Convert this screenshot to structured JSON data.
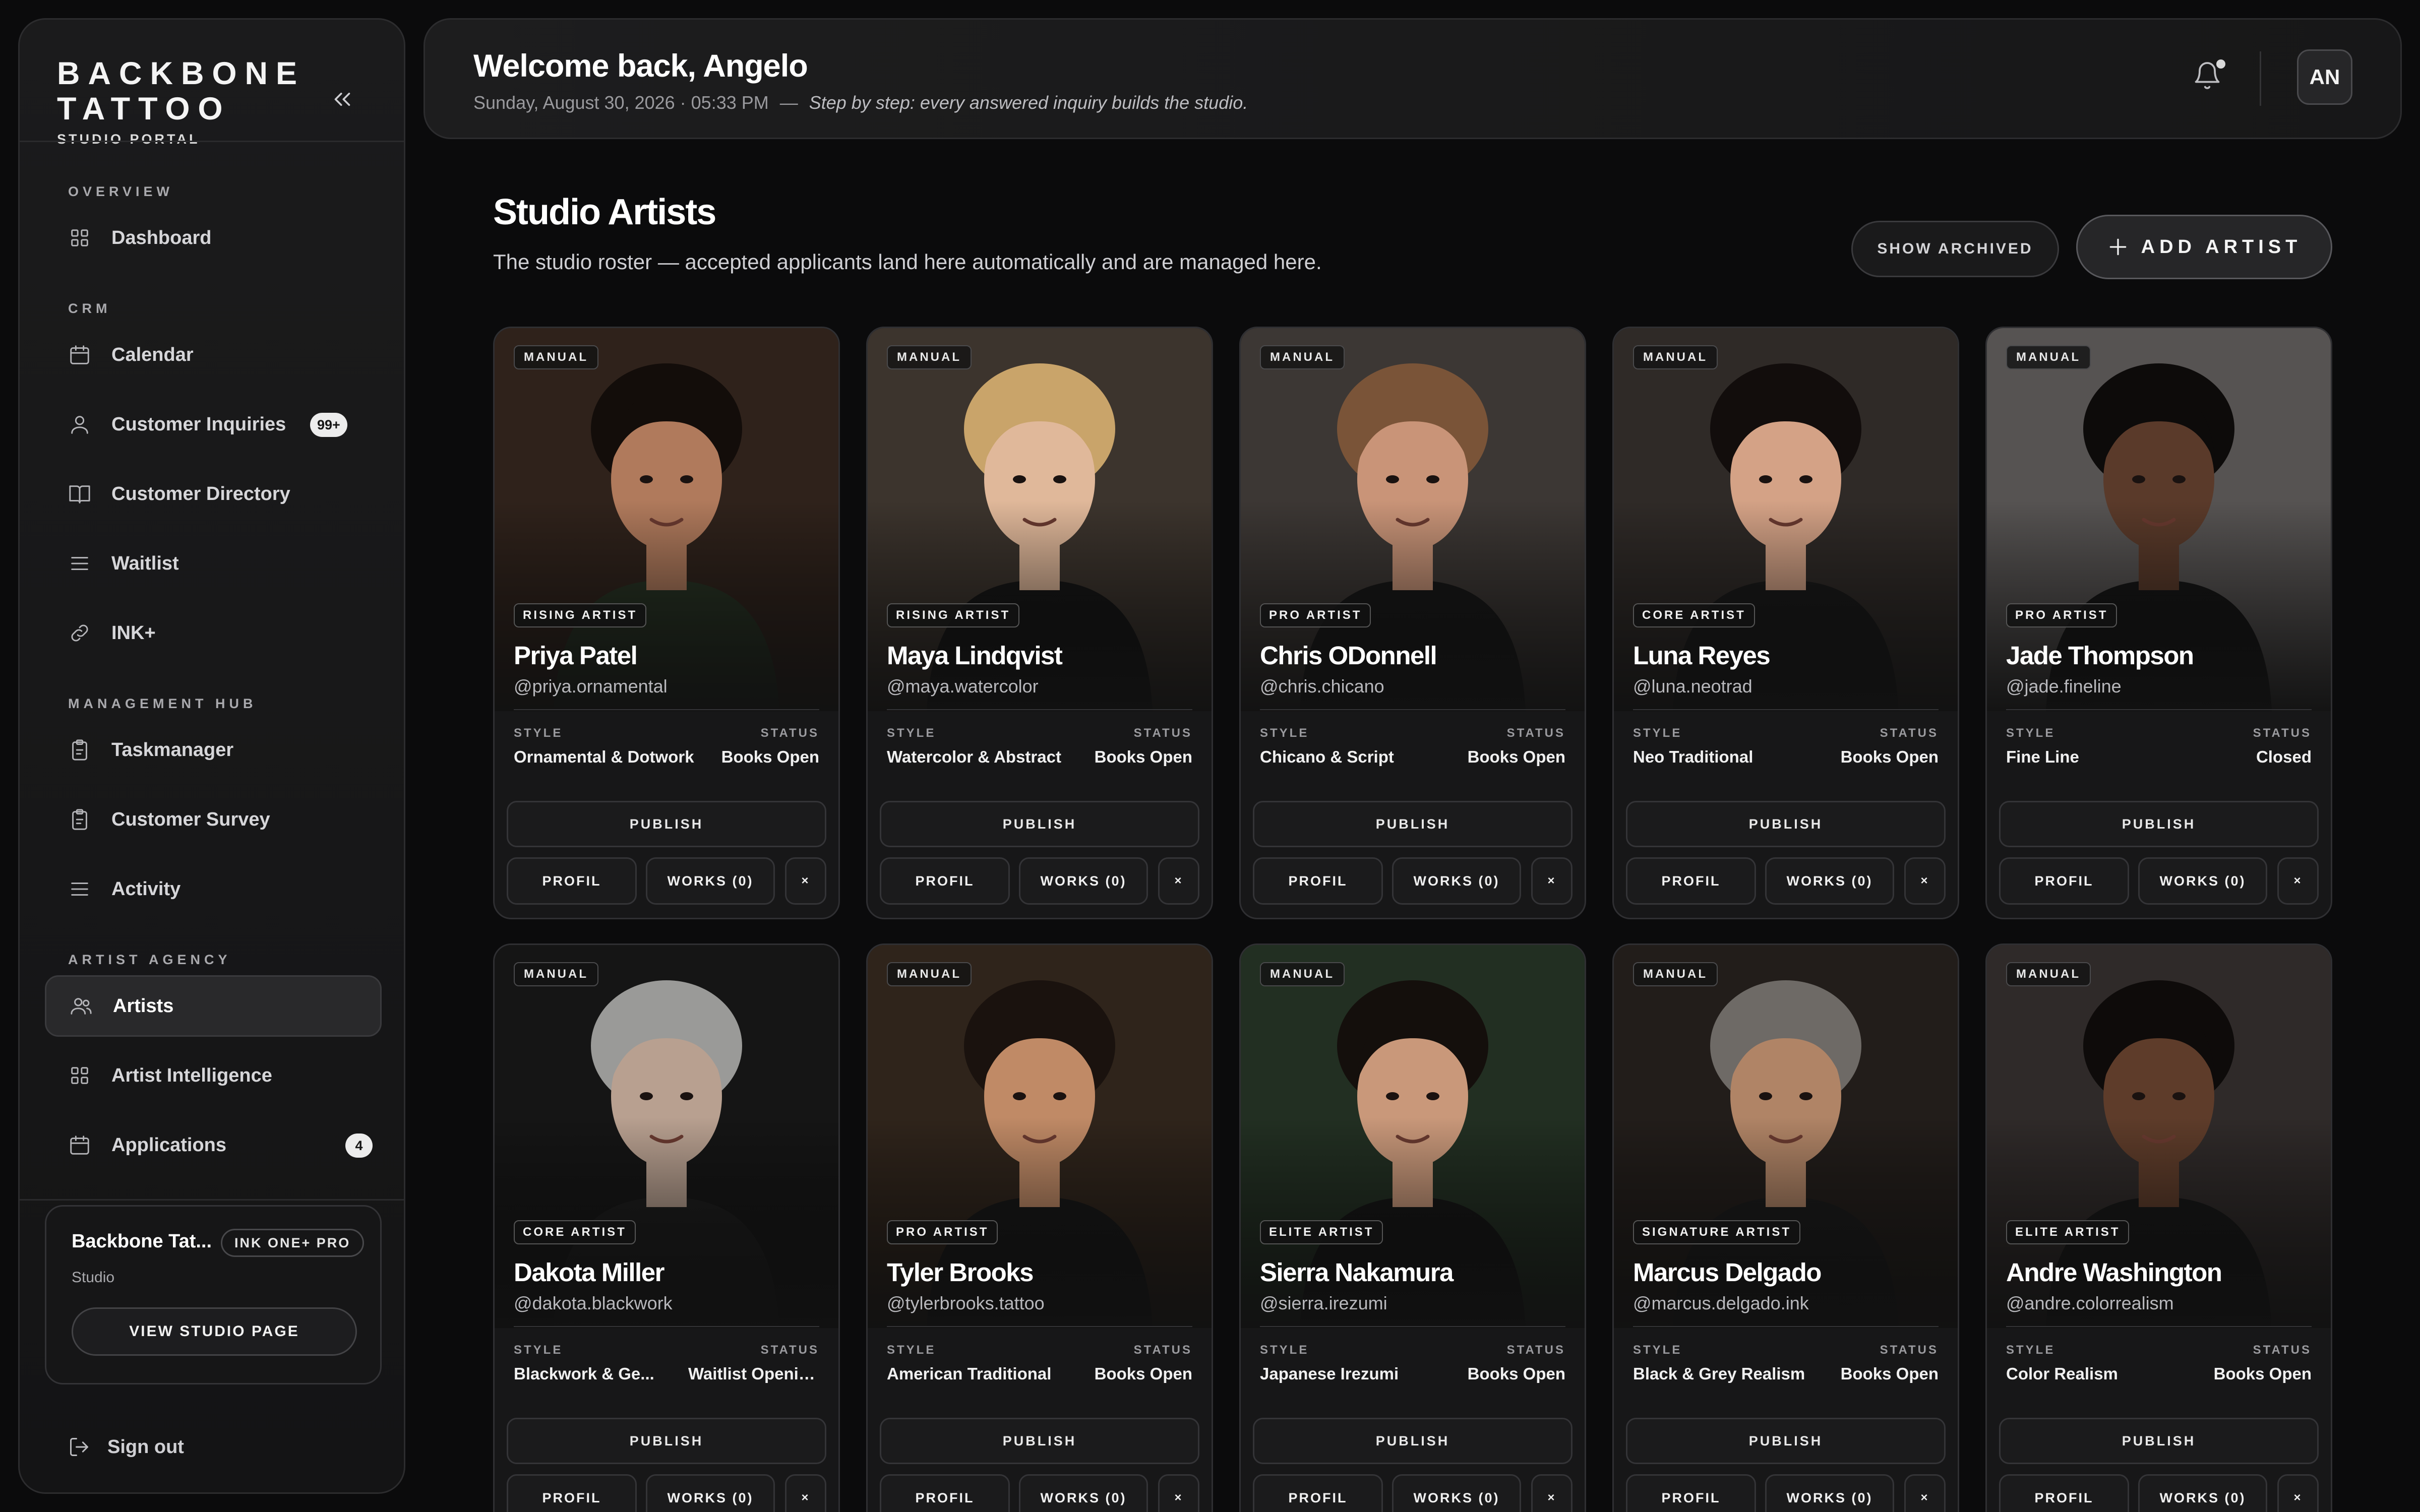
{
  "sidebar": {
    "brand_name": "BACKBONE TATTOO",
    "brand_sub": "STUDIO PORTAL",
    "sections": [
      {
        "title": "OVERVIEW",
        "items": [
          {
            "label": "Dashboard",
            "icon": "grid-icon"
          }
        ]
      },
      {
        "title": "CRM",
        "items": [
          {
            "label": "Calendar",
            "icon": "calendar-icon"
          },
          {
            "label": "Customer Inquiries",
            "icon": "user-icon",
            "badge": "99+"
          },
          {
            "label": "Customer Directory",
            "icon": "book-icon"
          },
          {
            "label": "Waitlist",
            "icon": "list-icon"
          },
          {
            "label": "INK+",
            "icon": "link-icon"
          }
        ]
      },
      {
        "title": "MANAGEMENT HUB",
        "items": [
          {
            "label": "Taskmanager",
            "icon": "clipboard-icon"
          },
          {
            "label": "Customer Survey",
            "icon": "clipboard-icon"
          },
          {
            "label": "Activity",
            "icon": "list-icon"
          }
        ]
      },
      {
        "title": "ARTIST AGENCY",
        "items": [
          {
            "label": "Artists",
            "icon": "users-icon",
            "active": true
          },
          {
            "label": "Artist Intelligence",
            "icon": "grid-icon"
          },
          {
            "label": "Applications",
            "icon": "calendar-icon",
            "badge": "4"
          }
        ]
      }
    ],
    "studio_card": {
      "name": "Backbone Tat...",
      "plan": "INK ONE+ PRO",
      "type": "Studio",
      "view_button": "VIEW STUDIO PAGE"
    },
    "sign_out": "Sign out"
  },
  "header": {
    "welcome": "Welcome back, Angelo",
    "date": "Sunday, August 30, 2026 · 05:33 PM",
    "separator": "—",
    "quote": "Step by step: every answered inquiry builds the studio.",
    "avatar": "AN"
  },
  "main": {
    "title": "Studio Artists",
    "subtitle": "The studio roster — accepted applicants land here automatically and are managed here.",
    "show_archived": "SHOW ARCHIVED",
    "add_artist": "ADD ARTIST"
  },
  "card_labels": {
    "source": "MANUAL",
    "style_key": "STYLE",
    "status_key": "STATUS",
    "publish": "PUBLISH",
    "profile": "PROFIL",
    "works": "WORKS (0)",
    "remove": "×"
  },
  "artists": [
    {
      "tier": "RISING ARTIST",
      "name": "Priya Patel",
      "handle": "@priya.ornamental",
      "style": "Ornamental & Dotwork",
      "status": "Books Open",
      "bg": "#3a2a22",
      "skin": "#b07a5c",
      "hair": "#130d0a",
      "shirt": "#263222"
    },
    {
      "tier": "RISING ARTIST",
      "name": "Maya Lindqvist",
      "handle": "@maya.watercolor",
      "style": "Watercolor & Abstract",
      "status": "Books Open",
      "bg": "#4a4038",
      "skin": "#e0b89a",
      "hair": "#c9a46a",
      "shirt": "#141414"
    },
    {
      "tier": "PRO ARTIST",
      "name": "Chris ODonnell",
      "handle": "@chris.chicano",
      "style": "Chicano & Script",
      "status": "Books Open",
      "bg": "#4a4440",
      "skin": "#c99478",
      "hair": "#7a5438",
      "shirt": "#161616"
    },
    {
      "tier": "CORE ARTIST",
      "name": "Luna Reyes",
      "handle": "@luna.neotrad",
      "style": "Neo Traditional",
      "status": "Books Open",
      "bg": "#3a3430",
      "skin": "#d4a286",
      "hair": "#120d0c",
      "shirt": "#181818"
    },
    {
      "tier": "PRO ARTIST",
      "name": "Jade Thompson",
      "handle": "@jade.fineline",
      "style": "Fine Line",
      "status": "Closed",
      "bg": "#6a6664",
      "skin": "#5a3a2a",
      "hair": "#0d0b0a",
      "shirt": "#141414"
    },
    {
      "tier": "CORE ARTIST",
      "name": "Dakota Miller",
      "handle": "@dakota.blackwork",
      "style": "Blackwork & Ge...",
      "status": "Waitlist Openin...",
      "bg": "#1a1a1a",
      "skin": "#b8a090",
      "hair": "#9a9a98",
      "shirt": "#1c1c1c"
    },
    {
      "tier": "PRO ARTIST",
      "name": "Tyler Brooks",
      "handle": "@tylerbrooks.tattoo",
      "style": "American Traditional",
      "status": "Books Open",
      "bg": "#3a2c22",
      "skin": "#c08a66",
      "hair": "#1a120e",
      "shirt": "#161616"
    },
    {
      "tier": "ELITE ARTIST",
      "name": "Sierra Nakamura",
      "handle": "@sierra.irezumi",
      "style": "Japanese Irezumi",
      "status": "Books Open",
      "bg": "#2a3a2a",
      "skin": "#c9987a",
      "hair": "#140f0c",
      "shirt": "#141414"
    },
    {
      "tier": "SIGNATURE ARTIST",
      "name": "Marcus Delgado",
      "handle": "@marcus.delgado.ink",
      "style": "Black & Grey Realism",
      "status": "Books Open",
      "bg": "#2a2420",
      "skin": "#b08466",
      "hair": "#6e6a66",
      "shirt": "#1a1a1a"
    },
    {
      "tier": "ELITE ARTIST",
      "name": "Andre Washington",
      "handle": "@andre.colorrealism",
      "style": "Color Realism",
      "status": "Books Open",
      "bg": "#3a3432",
      "skin": "#5e3c2a",
      "hair": "#0e0b0a",
      "shirt": "#161616"
    }
  ]
}
